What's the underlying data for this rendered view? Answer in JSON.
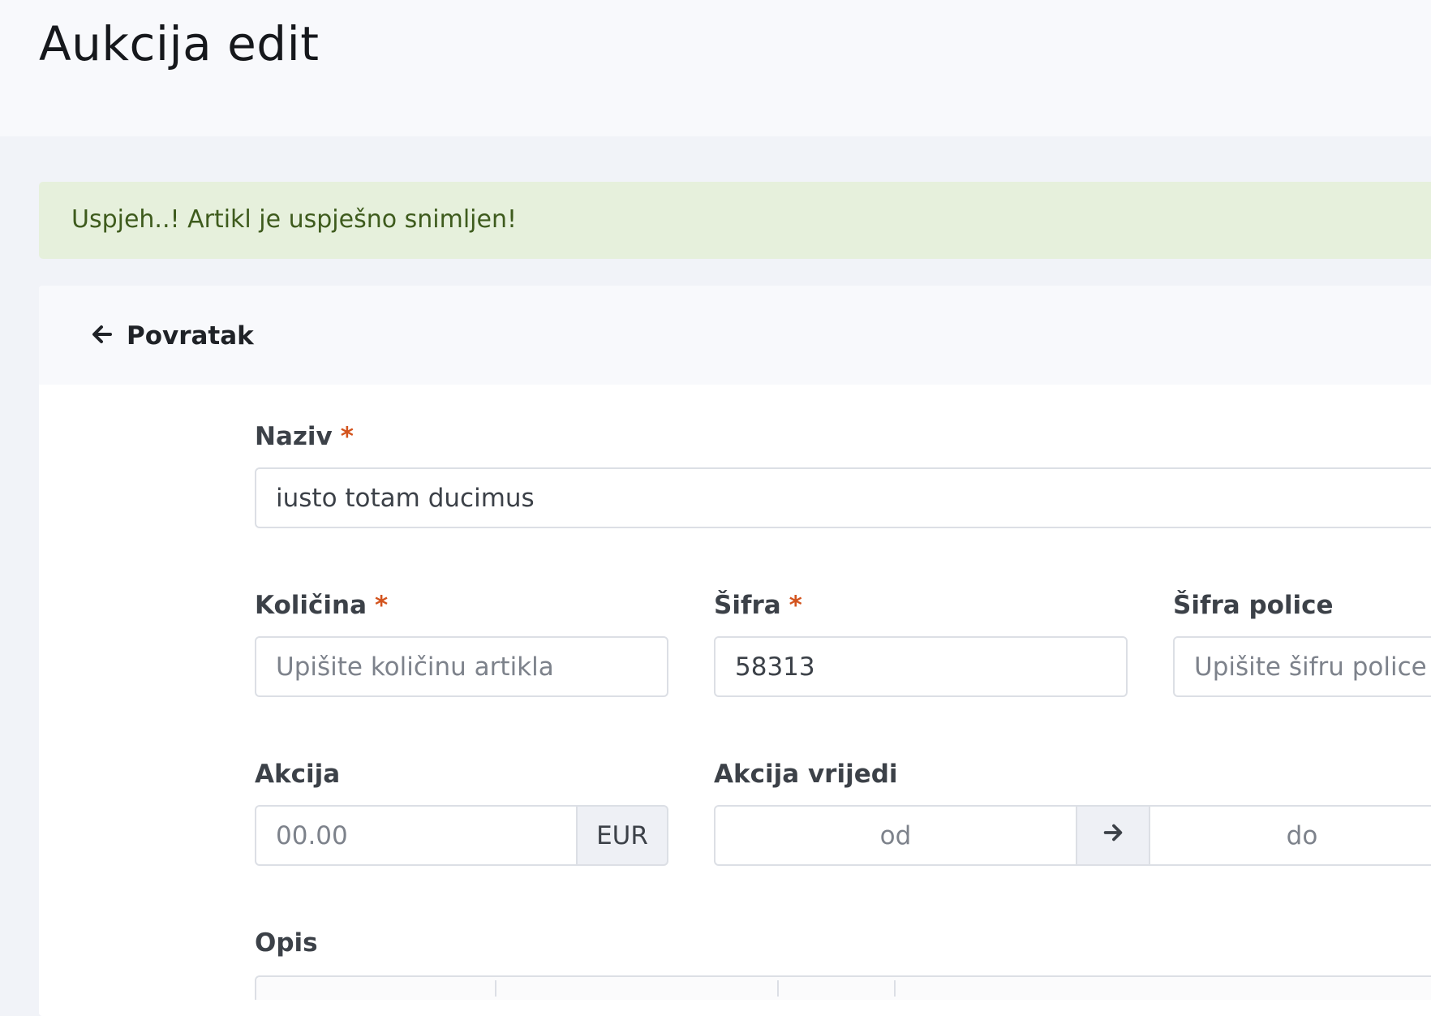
{
  "header": {
    "title": "Aukcija edit"
  },
  "alert": {
    "message": "Uspjeh..! Artikl je uspješno snimljen!"
  },
  "card": {
    "back_label": "Povratak"
  },
  "form": {
    "required_mark": "*",
    "naziv": {
      "label": "Naziv",
      "value": "iusto totam ducimus",
      "required": true
    },
    "kolicina": {
      "label": "Količina",
      "placeholder": "Upišite količinu artikla",
      "required": true
    },
    "sifra": {
      "label": "Šifra",
      "value": "58313",
      "required": true
    },
    "sifra_police": {
      "label": "Šifra police",
      "placeholder": "Upišite šifru police"
    },
    "akcija": {
      "label": "Akcija",
      "placeholder": "00.00",
      "currency": "EUR"
    },
    "akcija_vrijedi": {
      "label": "Akcija vrijedi",
      "from_placeholder": "od",
      "to_placeholder": "do"
    },
    "opis": {
      "label": "Opis"
    }
  },
  "colors": {
    "page_bg": "#f1f3f8",
    "alert_bg": "#e6f0dc",
    "alert_text": "#3e5b1d",
    "required": "#d3541e"
  },
  "icons": {
    "back": "arrow-left-icon",
    "range": "arrow-right-icon"
  }
}
